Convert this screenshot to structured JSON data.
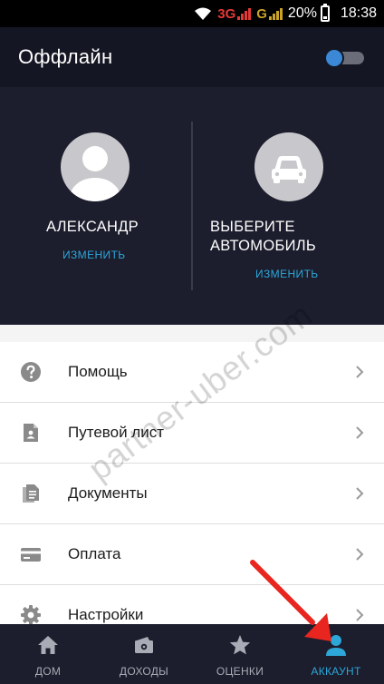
{
  "status_bar": {
    "network_3g": "3G",
    "network_g": "G",
    "battery": "20%",
    "time": "18:38",
    "icons": [
      "wifi-icon",
      "signal-icon",
      "battery-icon"
    ]
  },
  "header": {
    "title": "Оффлайн",
    "online_toggle": {
      "on": false,
      "knob_color": "#3b88d6"
    }
  },
  "profile": {
    "driver": {
      "name": "АЛЕКСАНДР",
      "action": "ИЗМЕНИТЬ"
    },
    "vehicle": {
      "name_line1": "ВЫБЕРИТЕ",
      "name_line2": "АВТОМОБИЛЬ",
      "action": "ИЗМЕНИТЬ"
    }
  },
  "menu": {
    "items": [
      {
        "label": "Помощь",
        "icon": "help-icon"
      },
      {
        "label": "Путевой лист",
        "icon": "waybill-icon"
      },
      {
        "label": "Документы",
        "icon": "documents-icon"
      },
      {
        "label": "Оплата",
        "icon": "card-icon"
      },
      {
        "label": "Настройки",
        "icon": "settings-icon"
      }
    ]
  },
  "bottom_nav": {
    "tabs": [
      {
        "label": "ДОМ",
        "icon": "home-icon",
        "active": false
      },
      {
        "label": "ДОХОДЫ",
        "icon": "wallet-icon",
        "active": false
      },
      {
        "label": "ОЦЕНКИ",
        "icon": "star-icon",
        "active": false
      },
      {
        "label": "АККАУНТ",
        "icon": "person-icon",
        "active": true
      }
    ]
  },
  "watermark": "partner-uber.com",
  "colors": {
    "header_bg": "#141623",
    "profile_bg": "#1c1d2d",
    "accent": "#2da7d8",
    "arrow": "#e8261f"
  }
}
